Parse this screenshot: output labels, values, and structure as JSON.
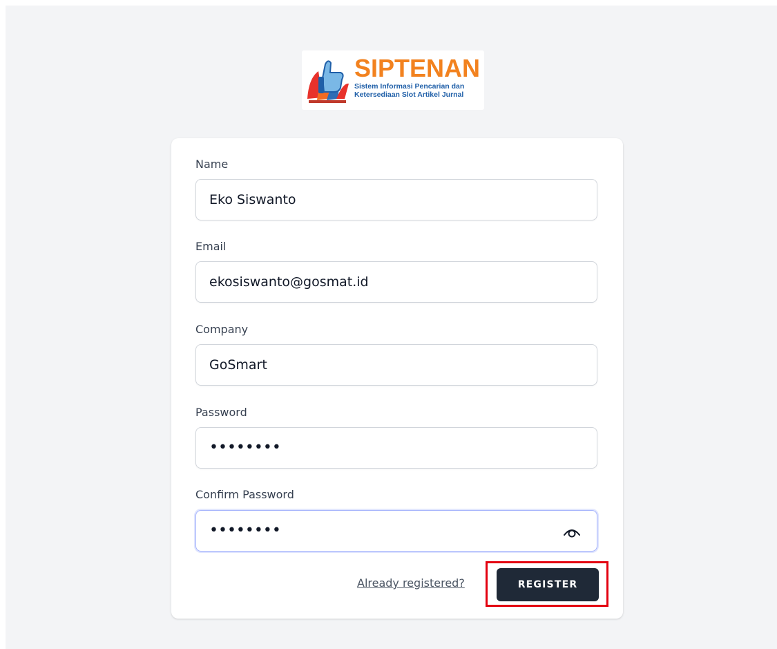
{
  "logo": {
    "title": "SIPTENAN",
    "subtitle_line1": "Sistem Informasi Pencarian dan",
    "subtitle_line2": "Ketersediaan Slot Artikel Jurnal",
    "colors": {
      "title": "#f2821f",
      "subtitle": "#1f5fa8"
    }
  },
  "form": {
    "fields": [
      {
        "label": "Name",
        "value": "Eko Siswanto"
      },
      {
        "label": "Email",
        "value": "ekosiswanto@gosmat.id"
      },
      {
        "label": "Company",
        "value": "GoSmart"
      },
      {
        "label": "Password",
        "value": "••••••••"
      },
      {
        "label": "Confirm Password",
        "value": "••••••••",
        "icon": "eye-icon"
      }
    ],
    "login_link": "Already registered?",
    "register_button": "REGISTER"
  },
  "colors": {
    "background": "#f3f4f6",
    "button": "#1f2937",
    "highlight": "#e3000f",
    "focus_border": "#a5b4fc"
  }
}
